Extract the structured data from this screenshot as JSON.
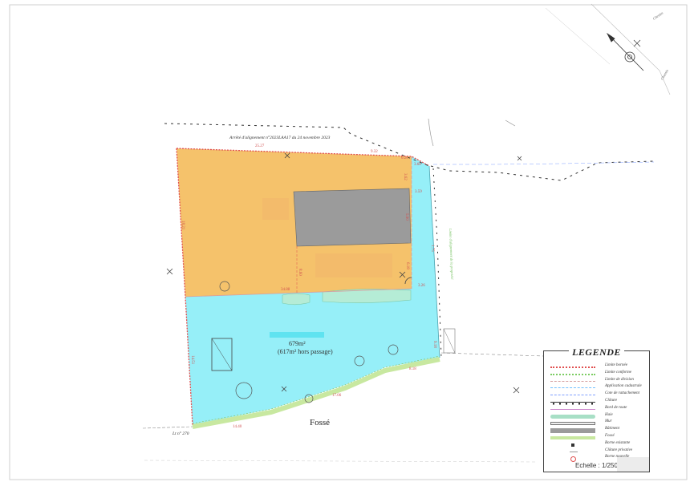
{
  "header": {
    "decree": "Arrêté d'alignement n°2023LAA17 du 24 novembre 2023"
  },
  "area": {
    "value": "679m²",
    "note": "(617m² hors passage)"
  },
  "ditch": "Fossé",
  "parcel_ref": "Lt n° 270",
  "dimensions": {
    "top_length": "25.27",
    "top_right": "9.32",
    "top_corner": "0.20",
    "right_top": "3.62",
    "left_side": "18.21",
    "building_side": "5.90",
    "building_right": "3.59",
    "center_vertical": "8.60",
    "bottom_inner": "34.88",
    "inner_corner": "6.18",
    "right_small": "1.75",
    "right_mid": "3.26",
    "right_side": "9.18",
    "left_lower": "14.51",
    "bottom_right": "8.18",
    "bottom_mid": "17.06",
    "bottom_left": "14.40",
    "northeast_label": "3.60"
  },
  "side_note": "Limite d'alignement de la propriété",
  "road_labels": {
    "label_a": "Chemin",
    "label_b": "Chemin"
  },
  "legend": {
    "title": "LEGENDE",
    "items": [
      {
        "label": "Limite bornée",
        "color": "#e05050"
      },
      {
        "label": "Limite conforme",
        "color": "#7ccc63"
      },
      {
        "label": "Limite de division",
        "color": "#d6a0a0"
      },
      {
        "label": "Application cadastrale",
        "color": "#70c0ff"
      },
      {
        "label": "Cote de rattachement",
        "color": "#80a0ff"
      },
      {
        "label": "Clôture",
        "color": "#333333"
      },
      {
        "label": "Bord de route",
        "color": "#cc88cc"
      },
      {
        "label": "Haie",
        "color": "#a8dfc6"
      },
      {
        "label": "Mur",
        "color": "#b0b0b0"
      },
      {
        "label": "Bâtiment",
        "color": "#9b9b9b"
      },
      {
        "label": "Fossé",
        "color": "#c8e8a0"
      },
      {
        "label": "Borne existante",
        "color": "#333333"
      },
      {
        "label": "Clôture privative",
        "color": "#999999"
      },
      {
        "label": "Borne nouvelle",
        "color": "#e05050"
      }
    ],
    "scale": "Echelle : 1/250"
  },
  "colors": {
    "lot_orange": "#f5c26b",
    "lot_cyan": "#96eff8",
    "building": "#9b9b9b",
    "hedge": "#b5ecd6",
    "boundary_red": "#e05050"
  }
}
